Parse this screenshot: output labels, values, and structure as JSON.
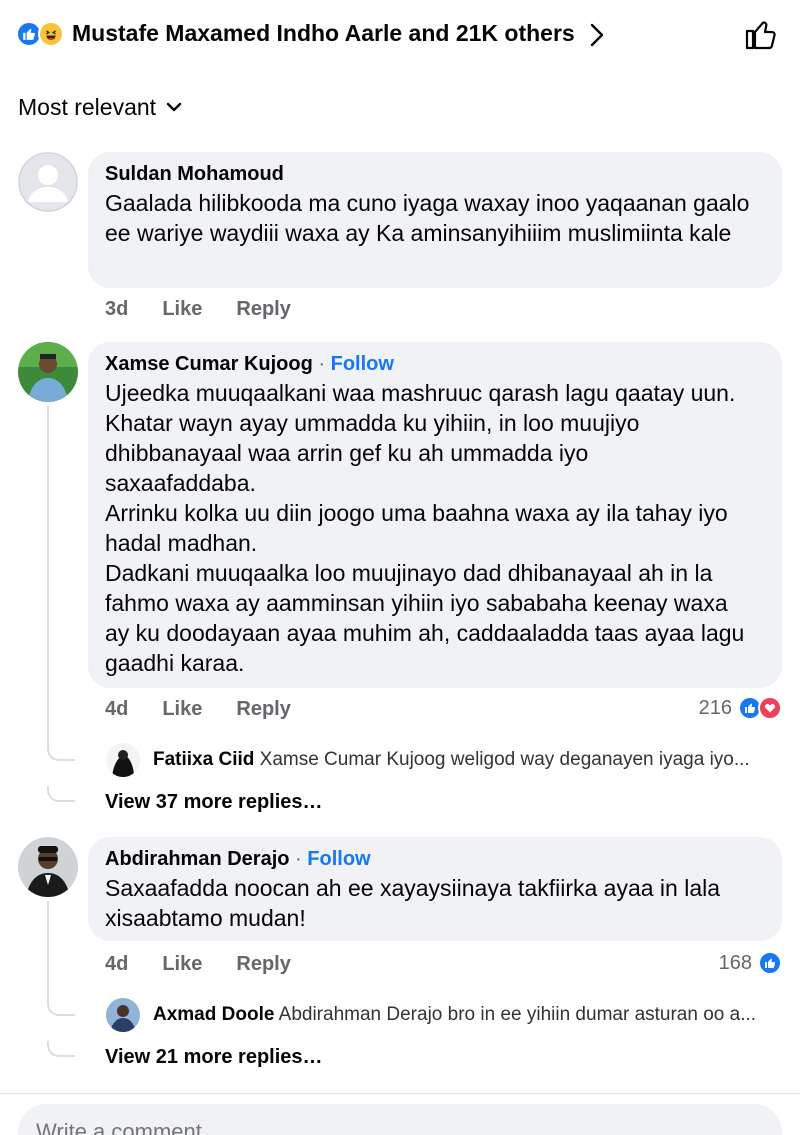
{
  "reactions": {
    "summary": "Mustafe Maxamed Indho Aarle and 21K others"
  },
  "sort": {
    "label": "Most relevant"
  },
  "comments": [
    {
      "author": "Suldan Mohamoud",
      "text": "Gaalada hilibkooda ma cuno iyaga waxay inoo yaqaanan gaalo ee wariye waydiii waxa ay Ka aminsanyihiiim muslimiinta kale",
      "time": "3d",
      "like": "Like",
      "reply": "Reply"
    },
    {
      "author": "Xamse Cumar Kujoog",
      "separator": "·",
      "follow": "Follow",
      "text_lines": [
        "Ujeedka muuqaalkani waa mashruuc qarash lagu qaatay uun.",
        "Khatar wayn ayay ummadda ku yihiin, in loo muujiyo",
        "dhibbanayaal waa arrin gef ku ah ummadda iyo",
        "saxaafaddaba.",
        "Arrinku kolka uu diin joogo uma baahna waxa ay ila tahay iyo",
        "hadal madhan.",
        "Dadkani muuqaalka loo muujinayo dad dhibanayaal ah in la",
        "fahmo waxa ay aamminsan yihiin iyo sababaha keenay waxa",
        "ay ku doodayaan ayaa muhim ah, caddaaladda taas ayaa lagu",
        "gaadhi karaa."
      ],
      "time": "4d",
      "like": "Like",
      "reply": "Reply",
      "reaction_count": "216",
      "reply_preview": {
        "author": "Fatiixa Ciid",
        "text": "Xamse Cumar Kujoog weligod way deganayen iyaga iyo..."
      },
      "more_replies": "View 37 more replies…"
    },
    {
      "author": "Abdirahman Derajo",
      "separator": "·",
      "follow": "Follow",
      "text_lines": [
        "Saxaafadda noocan ah ee xayaysiinaya takfiirka ayaa in lala",
        "xisaabtamo mudan!"
      ],
      "time": "4d",
      "like": "Like",
      "reply": "Reply",
      "reaction_count": "168",
      "reply_preview": {
        "author": "Axmad Doole",
        "text": "Abdirahman Derajo bro in ee yihiin dumar asturan oo a..."
      },
      "more_replies": "View 21 more replies…"
    }
  ],
  "composer": {
    "placeholder": "Write a comment..."
  },
  "colors": {
    "accent": "#1877f2",
    "bubble": "#f0f2f5",
    "muted": "#65676b",
    "love": "#f33e58"
  }
}
